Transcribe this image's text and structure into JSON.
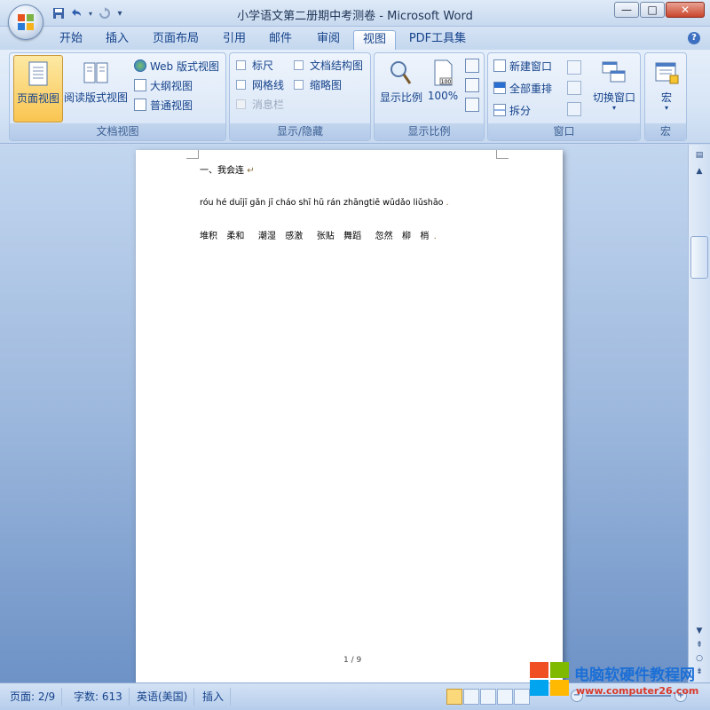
{
  "window": {
    "title": "小学语文第二册期中考测卷 - Microsoft Word",
    "controls": {
      "minimize": "—",
      "maximize": "□",
      "close": "✕"
    }
  },
  "quick_access": {
    "save_icon": "save-icon",
    "undo_icon": "undo-icon",
    "redo_icon": "redo-icon",
    "customize_icon": "dropdown-icon"
  },
  "tabs": [
    {
      "label": "开始"
    },
    {
      "label": "插入"
    },
    {
      "label": "页面布局"
    },
    {
      "label": "引用"
    },
    {
      "label": "邮件"
    },
    {
      "label": "审阅"
    },
    {
      "label": "视图",
      "active": true
    },
    {
      "label": "PDF工具集"
    }
  ],
  "ribbon": {
    "document_views": {
      "label": "文档视图",
      "print_layout": "页面视图",
      "full_screen_reading": "阅读版式视图",
      "web_layout": "Web 版式视图",
      "outline": "大纲视图",
      "draft": "普通视图"
    },
    "show_hide": {
      "label": "显示/隐藏",
      "ruler": "标尺",
      "gridlines": "网格线",
      "message_bar": "消息栏",
      "document_map": "文档结构图",
      "thumbnails": "缩略图"
    },
    "zoom": {
      "label": "显示比例",
      "zoom_button": "显示比例",
      "hundred_percent": "100%",
      "page_icon_text": "100"
    },
    "window": {
      "label": "窗口",
      "new_window": "新建窗口",
      "arrange_all": "全部重排",
      "split": "拆分",
      "switch_windows": "切换窗口"
    },
    "macros": {
      "label": "宏",
      "macros_button": "宏"
    }
  },
  "document": {
    "line1": "一、我会连",
    "line2": "róu hé duījī gǎn jī cháo shī hū rán zhāngtiē wǔdǎo liǔshāo",
    "line3": "堆积  柔和   潮湿  感激   张贴  舞蹈   忽然  柳  梢",
    "page_number": "1 / 9"
  },
  "status_bar": {
    "page": "页面: 2/9",
    "words": "字数: 613",
    "language": "英语(美国)",
    "mode": "插入"
  },
  "watermark": {
    "title": "电脑软硬件教程网",
    "url": "www.computer26.com"
  },
  "colors": {
    "accent": "#15428b",
    "ribbon_bg": "#dbe7f7",
    "active_button": "#fbd87a",
    "workspace": "#9db8dd"
  }
}
